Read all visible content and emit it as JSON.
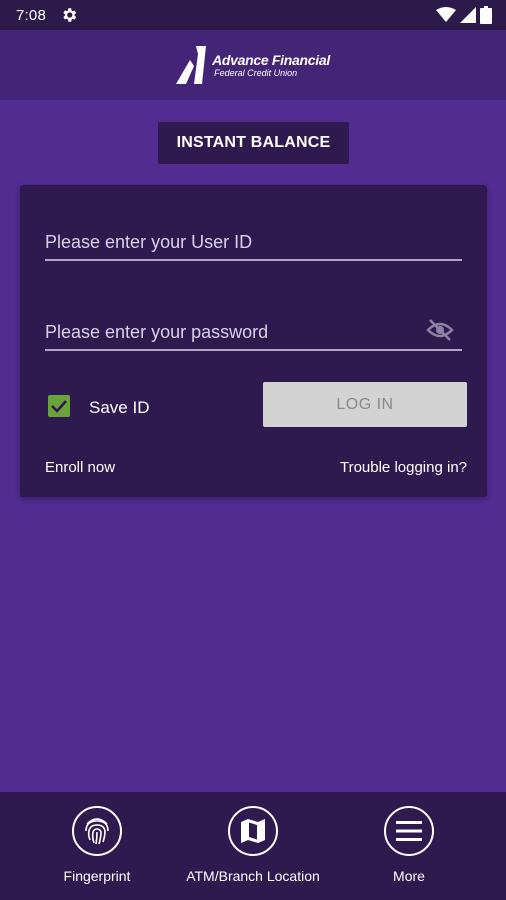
{
  "status_bar": {
    "time": "7:08",
    "icons": [
      "settings-gear-icon",
      "wifi-icon",
      "signal-icon",
      "battery-icon"
    ]
  },
  "header": {
    "logo_line1": "Advance Financial",
    "logo_line2": "Federal Credit Union"
  },
  "instant_balance": {
    "label": "INSTANT BALANCE"
  },
  "login_card": {
    "user_id_placeholder": "Please enter your User ID",
    "password_placeholder": "Please enter your password",
    "save_id_label": "Save ID",
    "save_id_checked": true,
    "login_label": "LOG IN",
    "enroll_label": "Enroll now",
    "trouble_label": "Trouble logging in?"
  },
  "bottom_nav": [
    {
      "label": "Fingerprint",
      "icon": "fingerprint-icon"
    },
    {
      "label": "ATM/Branch Location",
      "icon": "map-icon"
    },
    {
      "label": "More",
      "icon": "menu-icon"
    }
  ],
  "colors": {
    "background": "#522c91",
    "header": "#432476",
    "card": "#2f1a50",
    "checkbox": "#6aa33a",
    "login_button": "#d3d3d3"
  }
}
